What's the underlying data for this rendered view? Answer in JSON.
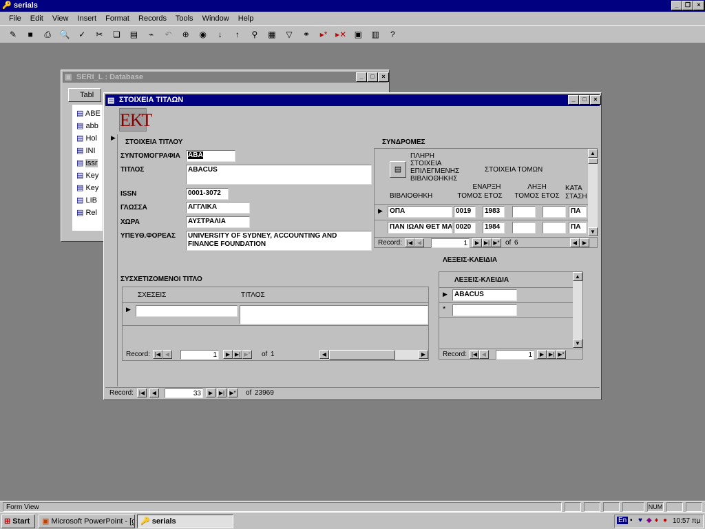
{
  "app": {
    "title": "serials"
  },
  "menu": [
    "File",
    "Edit",
    "View",
    "Insert",
    "Format",
    "Records",
    "Tools",
    "Window",
    "Help"
  ],
  "toolbar_icons": [
    "design-view-icon",
    "save-icon",
    "print-icon",
    "print-preview-icon",
    "spelling-icon",
    "cut-icon",
    "copy-icon",
    "paste-icon",
    "format-painter-icon",
    "undo-icon",
    "insert-hyperlink-icon",
    "web-toolbar-icon",
    "sort-ascending-icon",
    "sort-descending-icon",
    "filter-by-selection-icon",
    "filter-by-form-icon",
    "apply-filter-icon",
    "find-icon",
    "new-record-icon",
    "delete-record-icon",
    "database-window-icon",
    "new-object-icon",
    "help-icon"
  ],
  "db_window": {
    "title": "SERI_L : Database",
    "tab_first": "Tabl",
    "items": [
      "ABE",
      "abb",
      "Hol",
      "INI",
      "issr",
      "Key",
      "Key",
      "LIB",
      "Rel"
    ]
  },
  "form": {
    "title": "ΣΤΟΙΧΕΙΑ ΤΙΤΛΩΝ",
    "logo": "ΕΚΤ",
    "section_title": "ΣΤΟΙΧΕΙΑ ΤΙΤΛΟΥ",
    "fields": {
      "abbrev_label": "ΣΥΝΤΟΜΟΓΡΑΦΙΑ",
      "abbrev_value": "ABA",
      "title_label": "ΤΙΤΛΟΣ",
      "title_value": "ABACUS",
      "issn_label": "ISSN",
      "issn_value": "0001-3072",
      "language_label": "ΓΛΩΣΣΑ",
      "language_value": "ΑΓΓΛΙΚΑ",
      "country_label": "ΧΩΡΑ",
      "country_value": "ΑΥΣΤΡΑΛΙΑ",
      "body_label": "ΥΠΕΥΘ.ΦΟΡΕΑΣ",
      "body_value_1": "UNIVERSITY OF SYDNEY, ACCOUNTING AND",
      "body_value_2": "FINANCE FOUNDATION"
    },
    "subscriptions": {
      "title": "ΣΥΝΔΡΟΜΕΣ",
      "library_button": [
        "ΠΛΗΡΗ",
        "ΣΤΟΙΧΕΙΑ",
        "ΕΠΙΛΕΓΜΕΝΗΣ",
        "ΒΙΒΛΙΟΘΗΚΗΣ"
      ],
      "volumes_header": "ΣΤΟΙΧΕΙΑ ΤΟΜΩΝ",
      "columns": {
        "library": "ΒΙΒΛΙΟΘΗΚΗ",
        "start_a": "ΕΝΑΡΞΗ",
        "start_b": "ΤΟΜΟΣ",
        "start_c": "ΕΤΟΣ",
        "end_a": "ΛΗΞΗ",
        "end_b": "ΤΟΜΟΣ",
        "end_c": "ΕΤΟΣ",
        "status_a": "ΚΑΤΑ",
        "status_b": "ΣΤΑΣΗ"
      },
      "rows": [
        {
          "library": "ΟΠΑ",
          "vol": "0019",
          "year": "1983",
          "end_vol": "",
          "end_year": "",
          "status": "ΠΑ"
        },
        {
          "library": "ΠΑΝ ΙΩΑΝ ΘΕΤ ΜΑ",
          "vol": "0020",
          "year": "1984",
          "end_vol": "",
          "end_year": "",
          "status": "ΠΑ"
        }
      ],
      "nav": {
        "label": "Record:",
        "current": "1",
        "of": "of",
        "total": "6"
      }
    },
    "keywords": {
      "title": "ΛΕΞΕΙΣ-ΚΛΕΙΔΙΑ",
      "header": "ΛΕΞΕΙΣ-ΚΛΕΙΔΙΑ",
      "rows": [
        "ABACUS"
      ],
      "nav": {
        "label": "Record:",
        "current": "1"
      }
    },
    "related": {
      "title": "ΣΥΣΧΕΤΙΖΟΜΕΝΟΙ ΤΙΤΛΟ",
      "col_relations": "ΣΧΕΣΕΙΣ",
      "col_title": "ΤΙΤΛΟΣ",
      "nav": {
        "label": "Record:",
        "current": "1",
        "of": "of",
        "total": "1"
      }
    },
    "nav": {
      "label": "Record:",
      "current": "33",
      "of": "of",
      "total": "23969"
    }
  },
  "status": {
    "text": "Form View",
    "num": "NUM"
  },
  "taskbar": {
    "start": "Start",
    "tasks": [
      "Microsoft PowerPoint - [gri...",
      "serials"
    ],
    "lang": "En",
    "clock": "10:57 πμ"
  }
}
